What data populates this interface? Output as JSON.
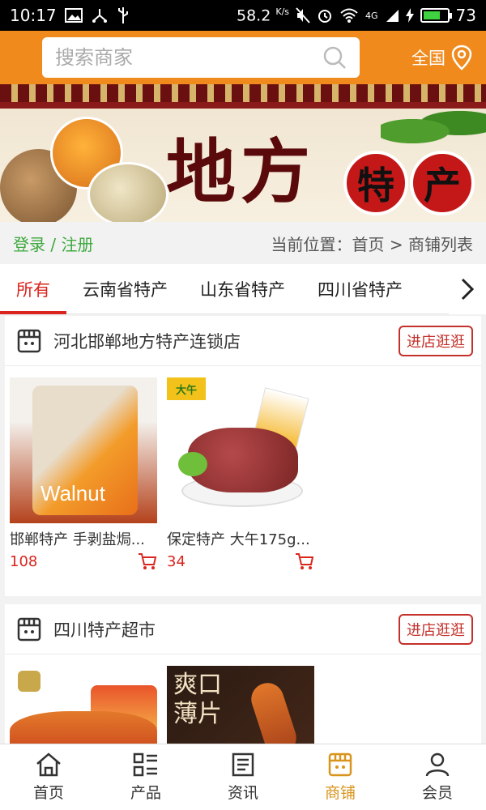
{
  "status_bar": {
    "time": "10:17",
    "speed": "58.2",
    "speed_unit": "K/s",
    "network": "4G",
    "battery": "73",
    "battery_level": 0.73
  },
  "header": {
    "search_placeholder": "搜索商家",
    "region_label": "全国"
  },
  "banner": {
    "title": "地方",
    "seal_1": "特",
    "seal_2": "产"
  },
  "location_bar": {
    "login_label": "登录 / 注册",
    "position_label": "当前位置：首页 > 商铺列表"
  },
  "tabs": [
    {
      "label": "所有",
      "active": true
    },
    {
      "label": "云南省特产"
    },
    {
      "label": "山东省特产"
    },
    {
      "label": "四川省特产"
    }
  ],
  "stores": [
    {
      "name": "河北邯郸地方特产连锁店",
      "button": "进店逛逛",
      "products": [
        {
          "name": "邯郸特产 手剥盐焗...",
          "price": "108",
          "image_text": "Walnut"
        },
        {
          "name": "保定特产 大午175g...",
          "price": "34",
          "image_text": "大午"
        }
      ]
    },
    {
      "name": "四川特产超市",
      "button": "进店逛逛",
      "products": [
        {
          "name": "",
          "price": ""
        },
        {
          "name": "",
          "price": "",
          "image_text": "爽口薄片"
        }
      ]
    }
  ],
  "bottom_nav": [
    {
      "label": "首页",
      "icon": "home-icon"
    },
    {
      "label": "产品",
      "icon": "list-icon"
    },
    {
      "label": "资讯",
      "icon": "news-icon"
    },
    {
      "label": "商铺",
      "icon": "shop-icon",
      "active": true
    },
    {
      "label": "会员",
      "icon": "user-icon"
    }
  ],
  "colors": {
    "header": "#f08a1c",
    "accent_red": "#d9251d",
    "login_green": "#3ea83e",
    "nav_active": "#d9941c"
  }
}
